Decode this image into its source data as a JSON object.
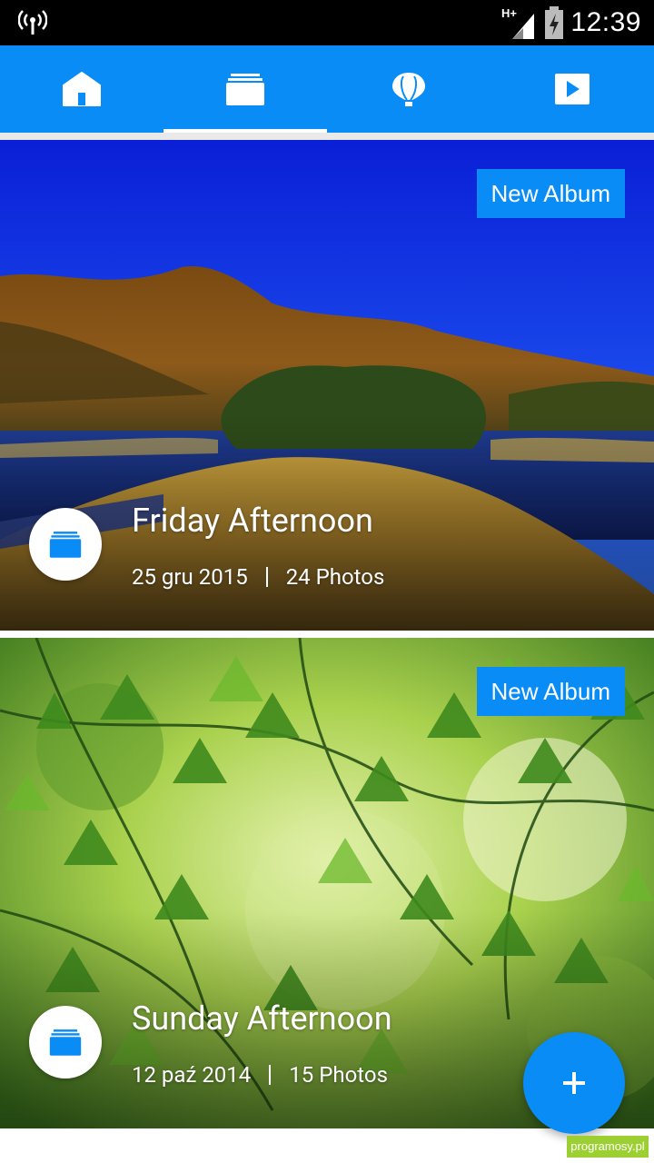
{
  "status_bar": {
    "time": "12:39",
    "network": "H+"
  },
  "tabs": [
    {
      "icon": "home-icon"
    },
    {
      "icon": "albums-icon"
    },
    {
      "icon": "balloon-icon"
    },
    {
      "icon": "play-icon"
    }
  ],
  "albums": [
    {
      "title": "Friday Afternoon",
      "date": "25 gru 2015",
      "photos": "24 Photos",
      "badge_label": "New Album"
    },
    {
      "title": "Sunday Afternoon",
      "date": "12 paź 2014",
      "photos": "15 Photos",
      "badge_label": "New Album"
    }
  ],
  "fab": {
    "icon": "plus-icon"
  },
  "watermark": "programosy.pl",
  "colors": {
    "accent": "#0a8cf7",
    "status_bar": "#000000"
  }
}
